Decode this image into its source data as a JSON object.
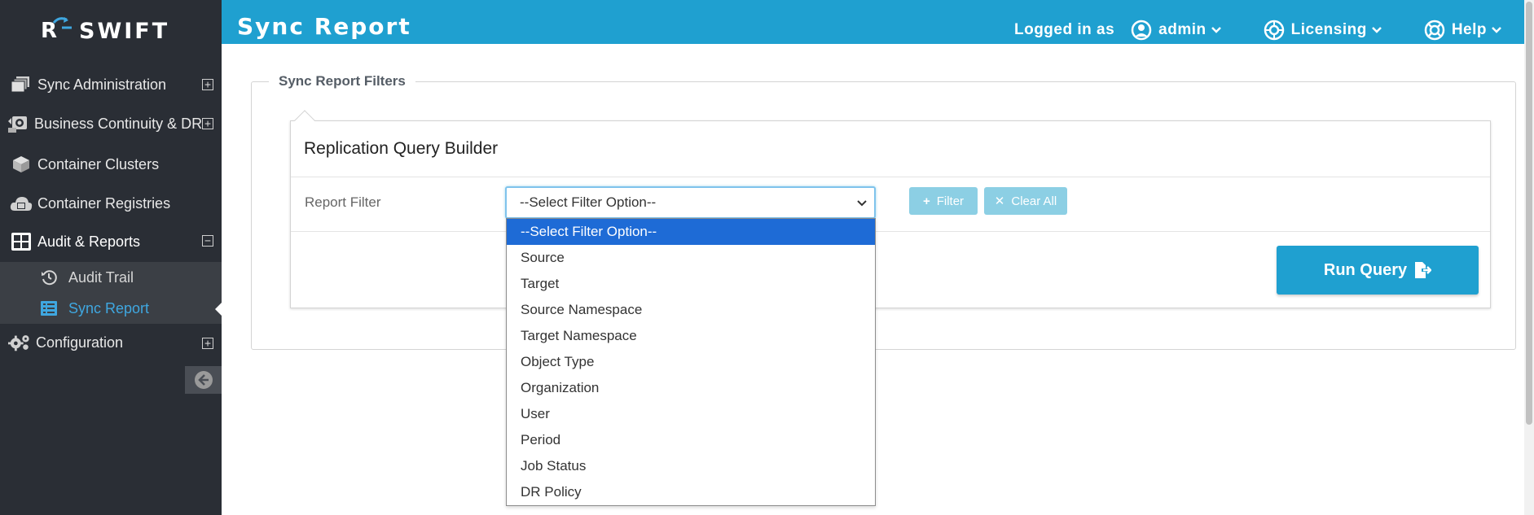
{
  "app": {
    "logo_letter": "R",
    "logo_text": "SWIFT"
  },
  "sidebar": {
    "items": [
      {
        "label": "Sync Administration",
        "icon": "layers-icon",
        "expander": "+"
      },
      {
        "label": "Business Continuity & DR",
        "icon": "recovery-icon",
        "expander": "+"
      },
      {
        "label": "Container Clusters",
        "icon": "cube-icon"
      },
      {
        "label": "Container Registries",
        "icon": "cloud-box-icon"
      },
      {
        "label": "Audit & Reports",
        "icon": "grid-icon",
        "expander": "−"
      }
    ],
    "sub_items": [
      {
        "label": "Audit Trail",
        "icon": "history-icon"
      },
      {
        "label": "Sync Report",
        "icon": "list-icon"
      }
    ],
    "config_item": {
      "label": "Configuration",
      "icon": "gears-icon",
      "expander": "+"
    }
  },
  "header": {
    "title": "Sync Report",
    "logged_in_label": "Logged in as",
    "user": "admin",
    "licensing": "Licensing",
    "help": "Help"
  },
  "filters": {
    "legend": "Sync Report Filters",
    "builder_title": "Replication Query Builder",
    "report_filter_label": "Report Filter",
    "select_value": "--Select Filter Option--",
    "filter_button": "Filter",
    "clear_button": "Clear All",
    "run_button": "Run Query",
    "options": [
      "--Select Filter Option--",
      "Source",
      "Target",
      "Source Namespace",
      "Target Namespace",
      "Object Type",
      "Organization",
      "User",
      "Period",
      "Job Status",
      "DR Policy"
    ]
  },
  "colors": {
    "header_bg": "#1fa0d0",
    "sidebar_bg": "#2a2e35",
    "active_link": "#3fa7e0",
    "button_disabled": "#8ccfe4",
    "option_selected": "#1e6bd6"
  }
}
